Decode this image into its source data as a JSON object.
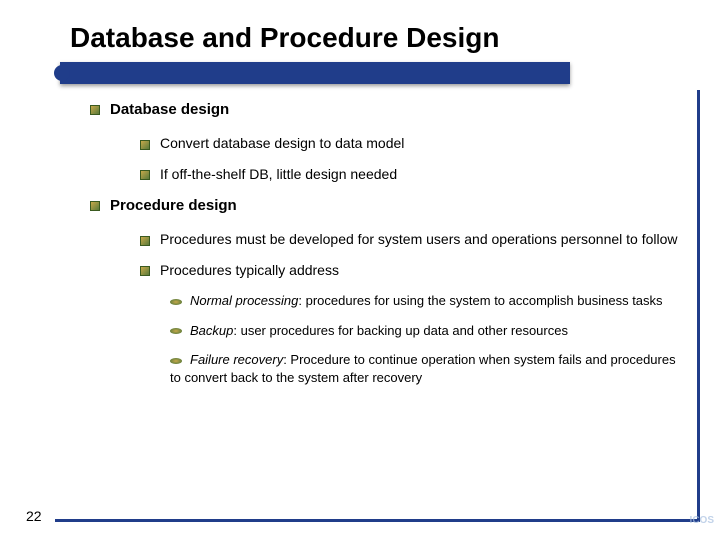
{
  "title": "Database and Procedure Design",
  "pageNumber": "22",
  "bullets": {
    "b1": "Database design",
    "b1a": "Convert database design to data model",
    "b1b": "If off-the-shelf DB, little design needed",
    "b2": "Procedure design",
    "b2a": "Procedures must be developed for system users and operations personnel to follow",
    "b2b": "Procedures typically address",
    "b2b1_i": "Normal processing",
    "b2b1_r": ": procedures for using the system to accomplish business tasks",
    "b2b2_i": "Backup",
    "b2b2_r": ": user procedures for backing up data and other resources",
    "b2b3_i": "Failure recovery",
    "b2b3_r": ": Procedure to continue operation when system fails and procedures to convert back to the system after recovery"
  },
  "ghost": "ICOS"
}
